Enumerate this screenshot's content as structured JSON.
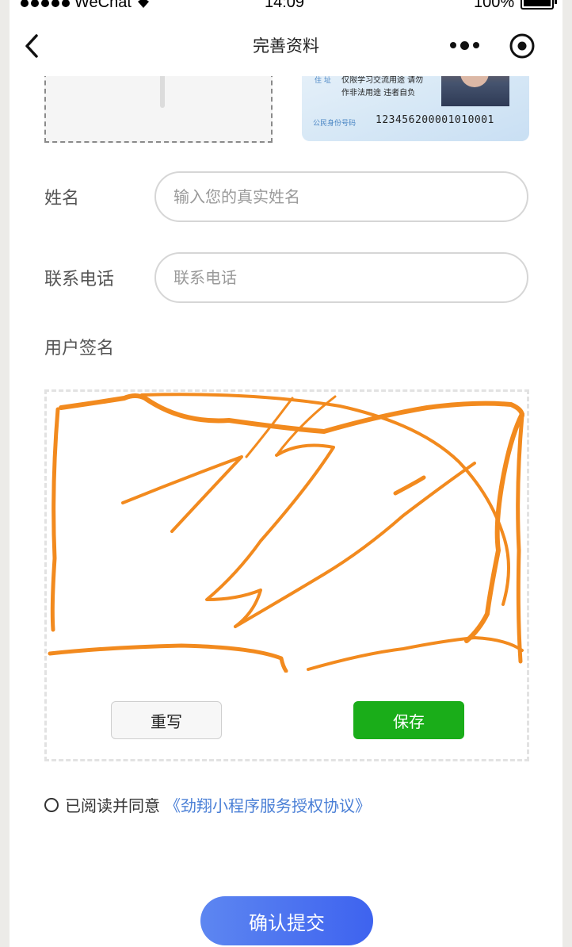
{
  "status_bar": {
    "carrier": "WeChat",
    "time": "14:09",
    "battery": "100%"
  },
  "nav": {
    "title": "完善资料",
    "icons": [
      "back-icon",
      "more-dots-icon",
      "close-target-icon"
    ]
  },
  "id_card": {
    "address_label": "住 址",
    "line1": "仅限学习交流用途 请勿",
    "line2": "作非法用途 违者自负",
    "number_label": "公民身份号码",
    "number": "123456200001010001"
  },
  "form": {
    "name_label": "姓名",
    "name_placeholder": "输入您的真实姓名",
    "name_value": "",
    "phone_label": "联系电话",
    "phone_placeholder": "联系电话",
    "phone_value": "",
    "signature_label": "用户签名"
  },
  "signature": {
    "stroke_color": "#f28a1e",
    "rewrite_label": "重写",
    "save_label": "保存"
  },
  "agreement": {
    "checked": false,
    "text": "已阅读并同意",
    "link_text": "《劲翔小程序服务授权协议》"
  },
  "submit_label": "确认提交",
  "colors": {
    "save_green": "#1aad19",
    "link_blue": "#4a7fd6",
    "submit_start": "#5d86f1",
    "submit_end": "#3e63ef"
  }
}
